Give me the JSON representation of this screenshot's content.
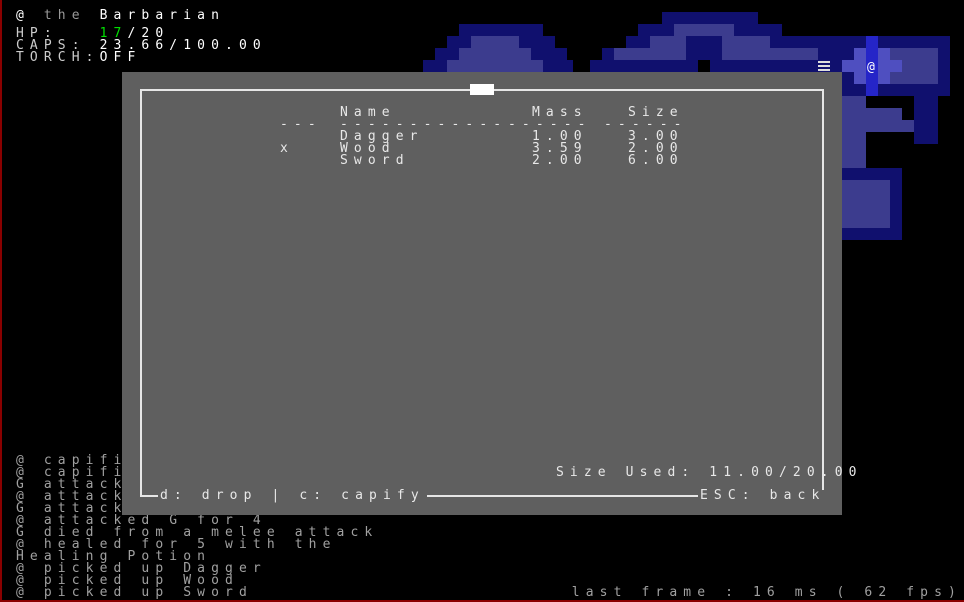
{
  "hud": {
    "player": "@",
    "article": "the",
    "class_name": "Barbarian",
    "hp_label": "HP:",
    "hp_current": "17",
    "hp_max": "/20",
    "caps_label": "CAPS:",
    "caps_value": "23.66/100.00",
    "torch_label": "TORCH:",
    "torch_value": "OFF"
  },
  "inventory": {
    "headers": {
      "selection": "---",
      "name": "Name",
      "name_rule": "------------",
      "mass": "Mass",
      "mass_rule": "------",
      "size": "Size",
      "size_rule": "------"
    },
    "items": [
      {
        "mark": "",
        "name": "Dagger",
        "mass": "1.00",
        "size": "3.00"
      },
      {
        "mark": "x",
        "name": "Wood",
        "mass": "3.59",
        "size": "2.00"
      },
      {
        "mark": "",
        "name": "Sword",
        "mass": "2.00",
        "size": "6.00"
      }
    ],
    "size_used": "Size Used: 11.00/20.00",
    "drop_capify": "d: drop | c: capify",
    "esc_back": "ESC: back"
  },
  "log": [
    "@ capifie",
    "@ capifie",
    "G attacke",
    "@ attacke",
    "G attacke",
    "@ attacked G for 4",
    "G died from a melee attack",
    "@ healed for 5 with the",
    "Healing Potion",
    "@ picked up Dagger",
    "@ picked up Wood",
    "@ picked up Sword"
  ],
  "map": {
    "player_glyph": "@",
    "colors": {
      "floor": "#3a3a8a",
      "wall": "#101075",
      "lit": "#4a4ab8",
      "player_bg": "#2b2bd0"
    }
  },
  "status": "last frame : 16 ms ( 62 fps)"
}
